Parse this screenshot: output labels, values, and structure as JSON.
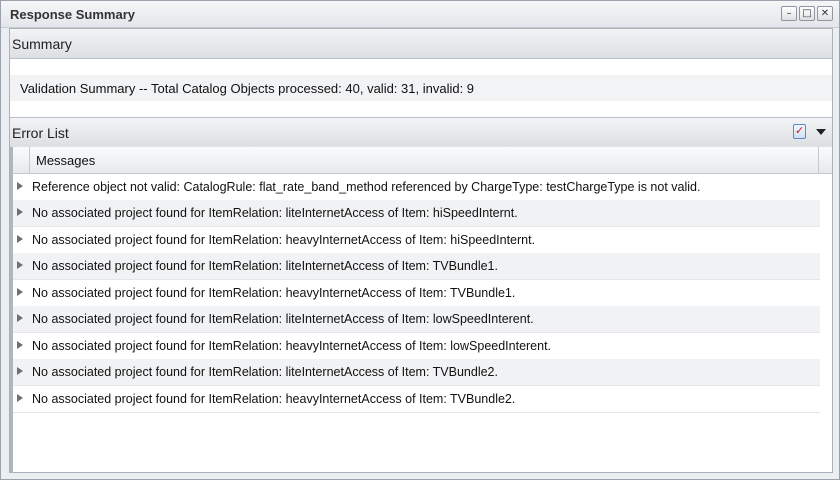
{
  "window": {
    "title": "Response Summary",
    "buttons": [
      "minimize",
      "maximize",
      "close"
    ]
  },
  "summary": {
    "header": "Summary",
    "text": "Validation Summary -- Total Catalog Objects processed: 40, valid: 31, invalid: 9"
  },
  "errors": {
    "header": "Error List",
    "column": "Messages",
    "icons": [
      "validate-icon",
      "dropdown-icon"
    ],
    "rows": [
      "Reference object not valid: CatalogRule: flat_rate_band_method referenced by ChargeType: testChargeType is not valid.",
      "No associated project found for ItemRelation: liteInternetAccess of Item: hiSpeedInternt.",
      "No associated project found for ItemRelation: heavyInternetAccess of Item: hiSpeedInternt.",
      "No associated project found for ItemRelation: liteInternetAccess of Item: TVBundle1.",
      "No associated project found for ItemRelation: heavyInternetAccess of Item: TVBundle1.",
      "No associated project found for ItemRelation: liteInternetAccess of Item: lowSpeedInterent.",
      "No associated project found for ItemRelation: heavyInternetAccess of Item: lowSpeedInterent.",
      "No associated project found for ItemRelation: liteInternetAccess of Item: TVBundle2.",
      "No associated project found for ItemRelation: heavyInternetAccess of Item: TVBundle2."
    ]
  }
}
